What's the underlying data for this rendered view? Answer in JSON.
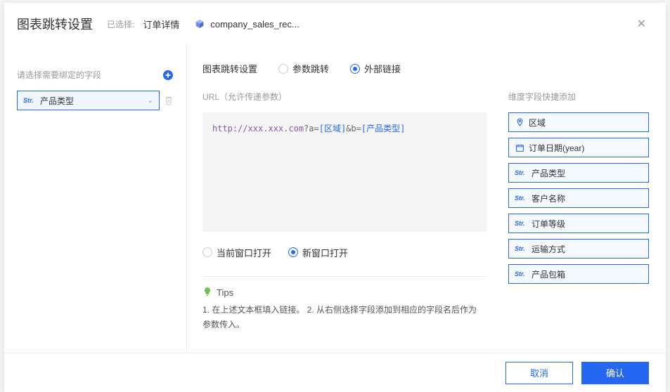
{
  "header": {
    "title": "图表跳转设置",
    "selected_label": "已选择:",
    "selected_value": "订单详情",
    "dataset_name": "company_sales_rec..."
  },
  "sidebar": {
    "label": "请选择需要绑定的字段",
    "field_type": "Str.",
    "field_name": "产品类型"
  },
  "tabs": {
    "main_label": "图表跳转设置",
    "radio1": "参数跳转",
    "radio2": "外部链接"
  },
  "url_section": {
    "label": "URL（允许传递参数）",
    "url_prefix": "http://xxx.xxx.com",
    "url_q1": "?a=",
    "url_var1": "[区域]",
    "url_q2": "&b=",
    "url_var2": "[产品类型]"
  },
  "open_mode": {
    "opt1": "当前窗口打开",
    "opt2": "新窗口打开"
  },
  "tips": {
    "title": "Tips",
    "text": "1. 在上述文本框填入链接。  2. 从右侧选择字段添加到相应的字段名后作为参数传入。"
  },
  "quick_add": {
    "label": "维度字段快捷添加",
    "items": [
      {
        "icon": "pin",
        "label": "区域"
      },
      {
        "icon": "calendar",
        "label": "订单日期(year)"
      },
      {
        "icon": "str",
        "label": "产品类型"
      },
      {
        "icon": "str",
        "label": "客户名称"
      },
      {
        "icon": "str",
        "label": "订单等级"
      },
      {
        "icon": "str",
        "label": "运输方式"
      },
      {
        "icon": "str",
        "label": "产品包箱"
      }
    ]
  },
  "footer": {
    "cancel": "取消",
    "confirm": "确认"
  }
}
